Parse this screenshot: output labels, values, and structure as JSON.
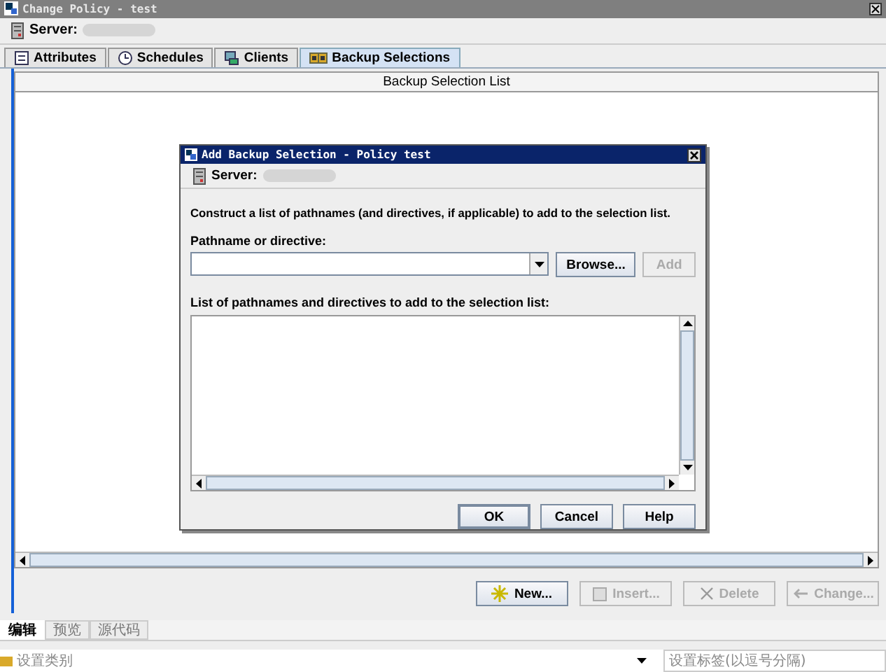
{
  "window": {
    "title": "Change Policy - test"
  },
  "server": {
    "label": "Server:"
  },
  "tabs": [
    {
      "label": "Attributes",
      "selected": false
    },
    {
      "label": "Schedules",
      "selected": false
    },
    {
      "label": "Clients",
      "selected": false
    },
    {
      "label": "Backup Selections",
      "selected": true
    }
  ],
  "list": {
    "header": "Backup Selection List"
  },
  "buttons": [
    {
      "label": "New...",
      "disabled": false
    },
    {
      "label": "Insert...",
      "disabled": true
    },
    {
      "label": "Delete",
      "disabled": true
    },
    {
      "label": "Change...",
      "disabled": true
    }
  ],
  "dialog": {
    "title": "Add Backup Selection - Policy test",
    "server_label": "Server:",
    "instruction": "Construct a list of pathnames (and directives, if applicable) to add to the selection list.",
    "path_label": "Pathname or directive:",
    "browse": {
      "label": "Browse...",
      "disabled": false
    },
    "add": {
      "label": "Add",
      "disabled": true
    },
    "list_label": "List of pathnames and directives to add to the selection list:",
    "buttons": [
      {
        "label": "OK",
        "default": true
      },
      {
        "label": "Cancel",
        "default": false
      },
      {
        "label": "Help",
        "default": false
      }
    ]
  },
  "editor_tabs": [
    {
      "label": "编辑",
      "selected": true
    },
    {
      "label": "预览",
      "selected": false
    },
    {
      "label": "源代码",
      "selected": false
    }
  ],
  "category_field": {
    "placeholder": "设置类别"
  },
  "tags_field": {
    "placeholder": "设置标签(以逗号分隔)"
  }
}
